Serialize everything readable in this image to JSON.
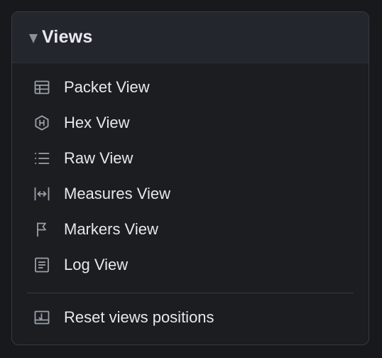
{
  "panel": {
    "title": "Views",
    "items": [
      {
        "label": "Packet View",
        "icon": "table-icon"
      },
      {
        "label": "Hex View",
        "icon": "hex-icon"
      },
      {
        "label": "Raw View",
        "icon": "list-icon"
      },
      {
        "label": "Measures View",
        "icon": "measure-icon"
      },
      {
        "label": "Markers View",
        "icon": "flag-icon"
      },
      {
        "label": "Log View",
        "icon": "log-icon"
      }
    ],
    "reset_label": "Reset views positions",
    "reset_icon": "reset-layout-icon"
  },
  "colors": {
    "background": "#17191c",
    "panel": "#1b1d21",
    "header": "#23262c",
    "border": "#363a40",
    "text": "#e6e8eb",
    "icon": "#9aa0a8"
  }
}
